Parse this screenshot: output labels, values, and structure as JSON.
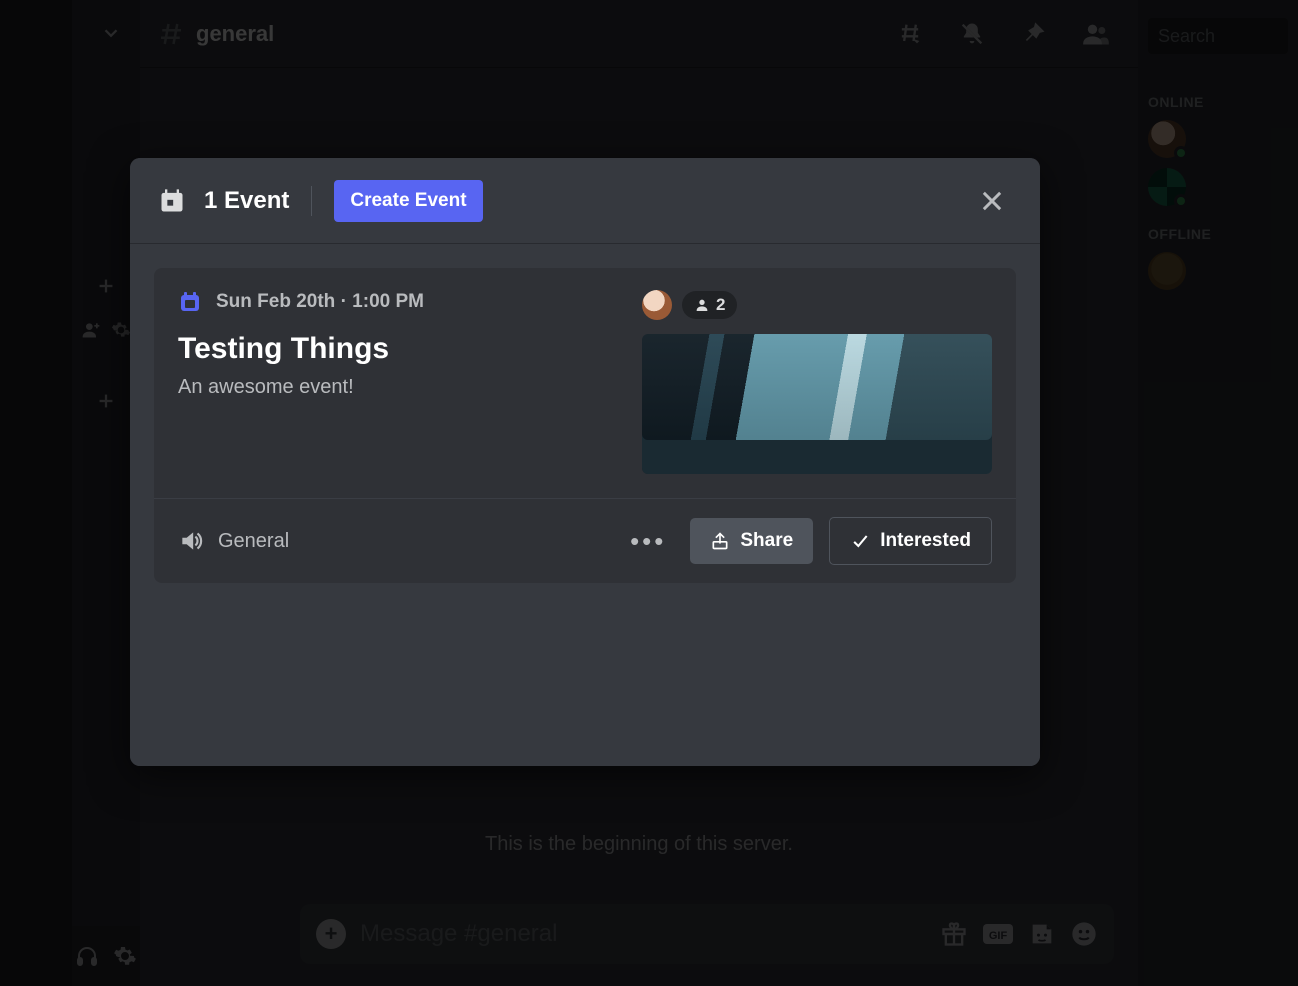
{
  "channel": {
    "name": "general"
  },
  "search": {
    "placeholder": "Search"
  },
  "members": {
    "online_header": "ONLINE",
    "offline_header": "OFFLINE"
  },
  "welcome": {
    "subtitle": "This is the beginning of this server."
  },
  "composer": {
    "placeholder": "Message #general"
  },
  "modal": {
    "title": "1 Event",
    "create_label": "Create Event",
    "event": {
      "date": "Sun Feb 20th · 1:00 PM",
      "title": "Testing Things",
      "description": "An awesome event!",
      "interested_count": "2",
      "location": "General"
    },
    "buttons": {
      "share": "Share",
      "interested": "Interested"
    }
  }
}
